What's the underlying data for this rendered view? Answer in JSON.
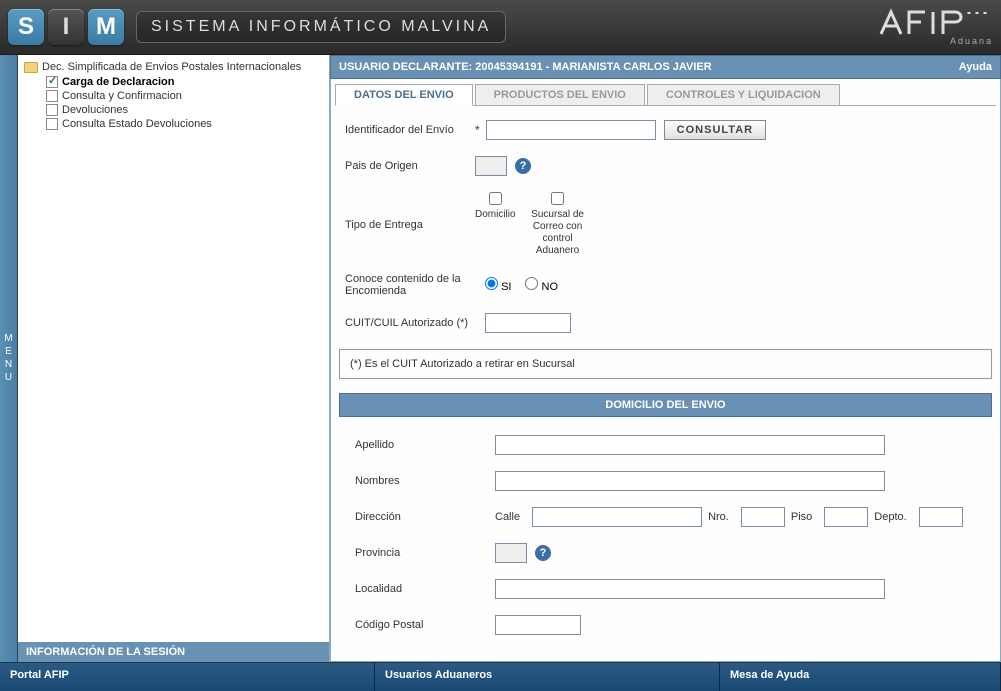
{
  "header": {
    "logo_s": "S",
    "logo_i": "I",
    "logo_m": "M",
    "title": "Sistema Informático Malvina",
    "afip_sub": "Aduana"
  },
  "menu_rail": "MENU",
  "tree": {
    "root": "Dec. Simplificada de Envios Postales Internacionales",
    "items": [
      {
        "label": "Carga de Declaracion",
        "active": true
      },
      {
        "label": "Consulta y Confirmacion",
        "active": false
      },
      {
        "label": "Devoluciones",
        "active": false
      },
      {
        "label": "Consulta Estado Devoluciones",
        "active": false
      }
    ]
  },
  "session_bar": "INFORMACIÓN DE LA SESIÓN",
  "user_bar": {
    "text": "USUARIO DECLARANTE: 20045394191 - MARIANISTA CARLOS JAVIER",
    "help": "Ayuda"
  },
  "tabs": [
    {
      "label": "DATOS DEL ENVIO",
      "active": true
    },
    {
      "label": "PRODUCTOS DEL ENVIO",
      "active": false
    },
    {
      "label": "CONTROLES Y LIQUIDACION",
      "active": false
    }
  ],
  "form": {
    "id_envio_label": "Identificador del Envío",
    "req": "*",
    "consultar": "CONSULTAR",
    "pais_label": "Pais de Origen",
    "tipo_label": "Tipo de Entrega",
    "domicilio": "Domicilio",
    "sucursal": "Sucursal de Correo con control Aduanero",
    "conoce_label": "Conoce contenido de la Encomienda",
    "si": "SI",
    "no": "NO",
    "cuit_label": "CUIT/CUIL Autorizado (*)",
    "hint": "(*) Es el CUIT Autorizado a retirar en Sucursal"
  },
  "domicilio": {
    "section": "DOMICILIO DEL ENVIO",
    "apellido": "Apellido",
    "nombres": "Nombres",
    "direccion": "Dirección",
    "calle": "Calle",
    "nro": "Nro.",
    "piso": "Piso",
    "depto": "Depto.",
    "provincia": "Provincia",
    "localidad": "Localidad",
    "cp": "Código Postal"
  },
  "footer": {
    "portal": "Portal AFIP",
    "usuarios": "Usuarios Aduaneros",
    "mesa": "Mesa de Ayuda"
  }
}
